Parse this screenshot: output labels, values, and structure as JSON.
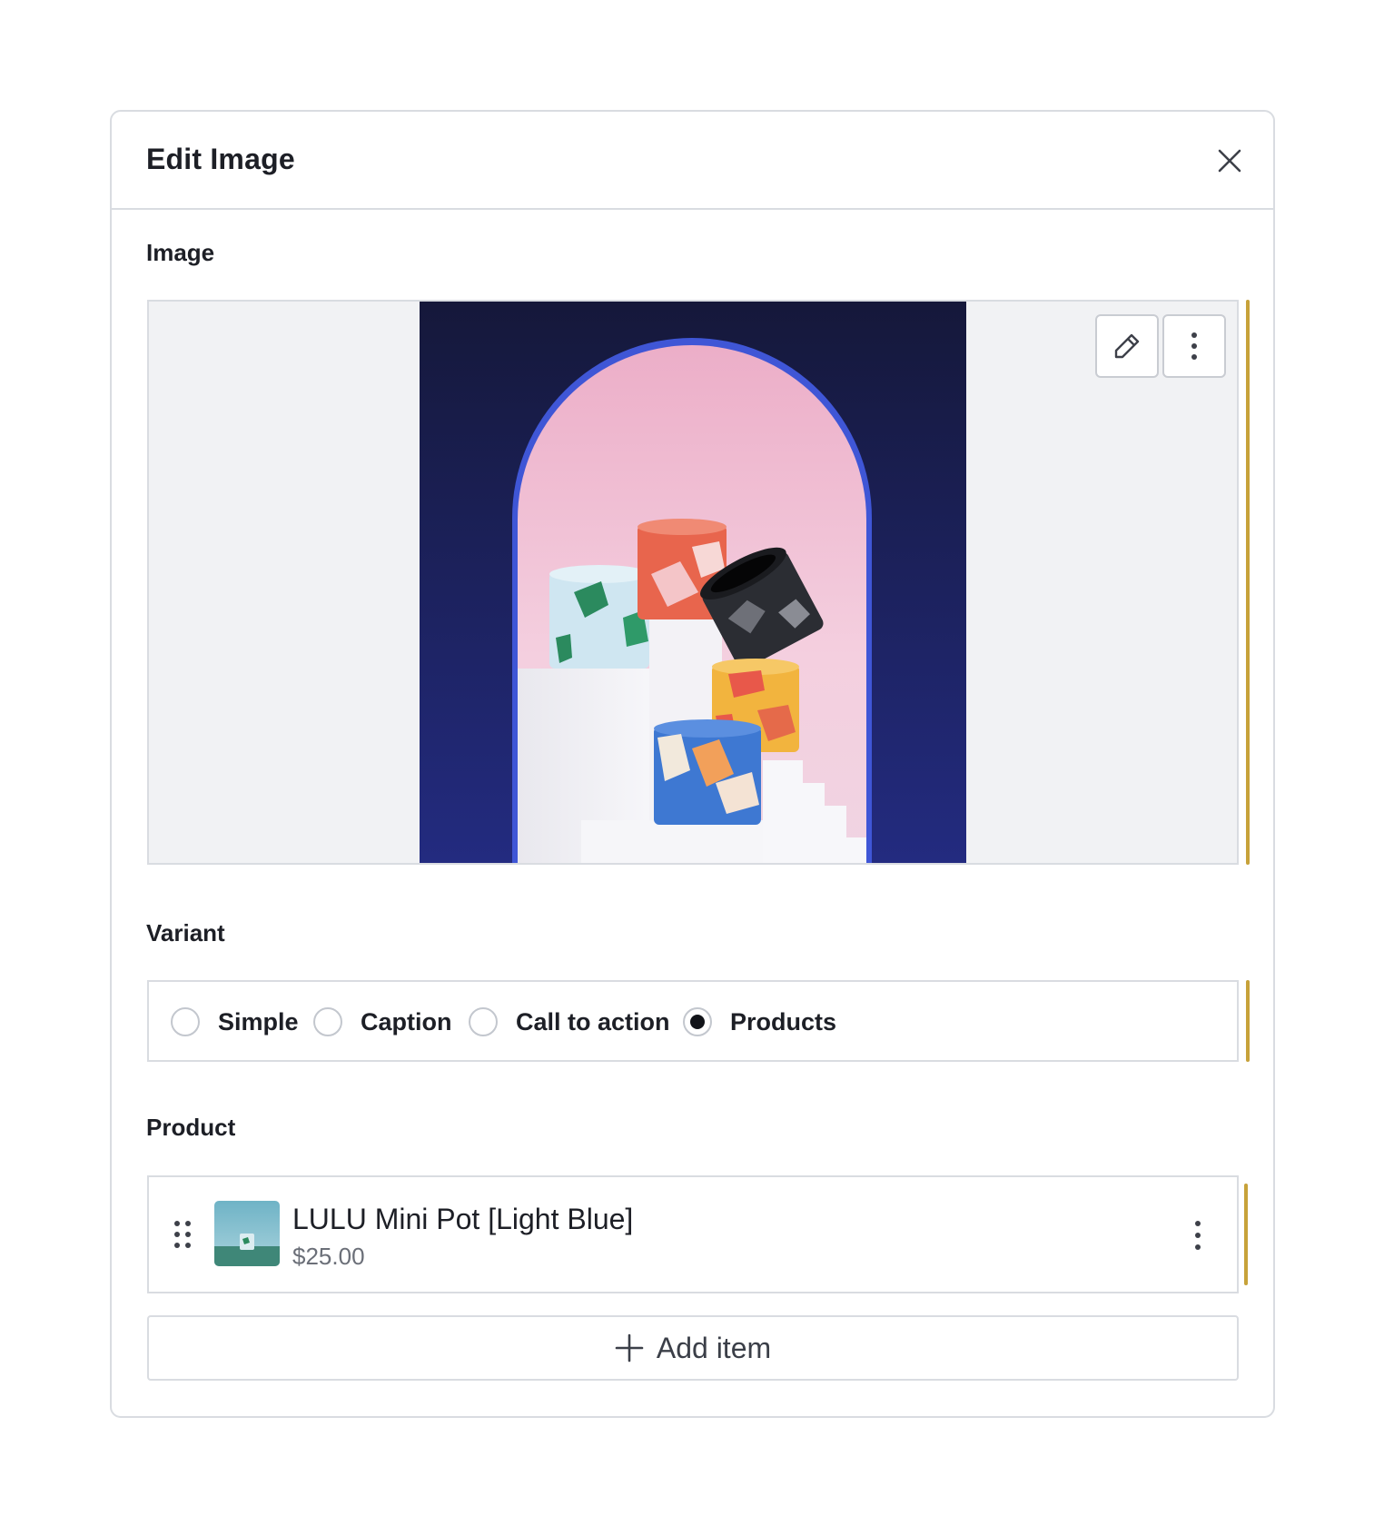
{
  "dialog": {
    "title": "Edit Image",
    "close_icon": "close-icon"
  },
  "image_section": {
    "label": "Image",
    "edit_icon": "pencil-icon",
    "more_icon": "vertical-dots-icon"
  },
  "variant_section": {
    "label": "Variant",
    "options": [
      {
        "label": "Simple",
        "selected": false
      },
      {
        "label": "Caption",
        "selected": false
      },
      {
        "label": "Call to action",
        "selected": false
      },
      {
        "label": "Products",
        "selected": true
      }
    ]
  },
  "product_section": {
    "label": "Product",
    "items": [
      {
        "name": "LULU Mini Pot [Light Blue]",
        "price": "$25.00"
      }
    ],
    "add_label": "Add item"
  },
  "colors": {
    "accent_bar": "#c7a23a",
    "border": "#d9dce1",
    "image_bg": "#f1f2f4"
  }
}
